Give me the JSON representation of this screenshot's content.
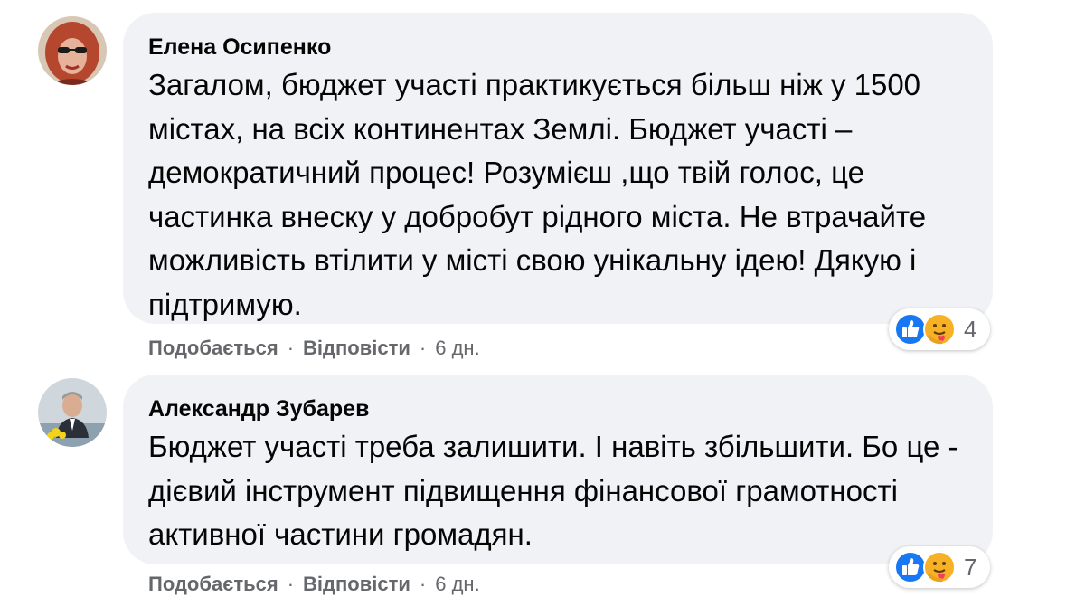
{
  "comments": [
    {
      "author": "Елена Осипенко",
      "text": "Загалом, бюджет участі практикується більш ніж у 1500 містах, на всіх континентах Землі. Бюджет участі – демократичний процес! Розумієш ,що твій голос, це частинка внеску у добробут рідного міста. Не втрачайте можливість втілити у місті свою унікальну ідею! Дякую і підтримую.",
      "like_label": "Подобається",
      "reply_label": "Відповісти",
      "time": "6 дн.",
      "reaction_count": "4",
      "reaction_icons": [
        "like-icon",
        "care-icon"
      ]
    },
    {
      "author": "Александр Зубарев",
      "text": "Бюджет участі треба залишити. І навіть збільшити. Бо це - дієвий інструмент підвищення фінансової грамотності активної частини громадян.",
      "like_label": "Подобається",
      "reply_label": "Відповісти",
      "time": "6 дн.",
      "reaction_count": "7",
      "reaction_icons": [
        "like-icon",
        "care-icon"
      ]
    }
  ],
  "separator": "·",
  "colors": {
    "bubble": "#f0f2f5",
    "text": "#050505",
    "meta": "#65676b",
    "like_blue": "#1877f2",
    "care_yellow": "#f7b125"
  }
}
